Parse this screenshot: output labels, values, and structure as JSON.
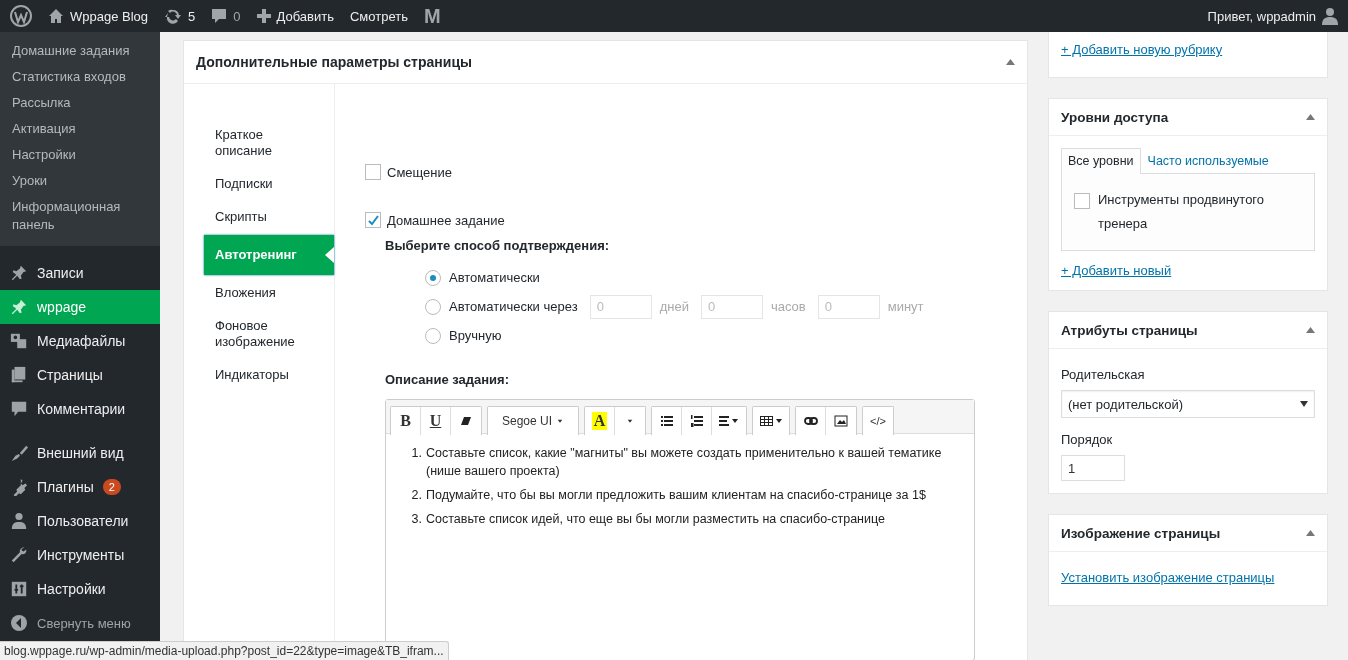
{
  "admin_bar": {
    "site": "Wppage Blog",
    "updates": "5",
    "comments": "0",
    "add": "Добавить",
    "view": "Смотреть",
    "plugin_logo": "M",
    "greeting": "Привет, wppadmin"
  },
  "sidebar": {
    "submenu": [
      "Домашние задания",
      "Статистика входов",
      "Рассылка",
      "Активация",
      "Настройки",
      "Уроки",
      "Информационная панель"
    ],
    "menu_groups": [
      [
        {
          "kind": "pin",
          "label": "Записи",
          "selected": false
        },
        {
          "kind": "pin",
          "label": "wppage",
          "selected": true
        },
        {
          "kind": "media",
          "label": "Медиафайлы",
          "selected": false
        },
        {
          "kind": "pages",
          "label": "Страницы",
          "selected": false
        },
        {
          "kind": "comments",
          "label": "Комментарии",
          "selected": false
        }
      ],
      [
        {
          "kind": "brush",
          "label": "Внешний вид",
          "selected": false
        },
        {
          "kind": "plug",
          "label": "Плагины",
          "selected": false,
          "badge": "2"
        },
        {
          "kind": "user",
          "label": "Пользователи",
          "selected": false
        },
        {
          "kind": "wrench",
          "label": "Инструменты",
          "selected": false
        },
        {
          "kind": "sliders",
          "label": "Настройки",
          "selected": false
        }
      ]
    ],
    "collapse": "Свернуть меню"
  },
  "panel": {
    "title": "Дополнительные параметры страницы",
    "tabs": [
      {
        "label": "Краткое описание",
        "selected": false
      },
      {
        "label": "Подписки",
        "selected": false
      },
      {
        "label": "Скрипты",
        "selected": false
      },
      {
        "label": "Автотренинг",
        "selected": true
      },
      {
        "label": "Вложения",
        "selected": false
      },
      {
        "label": "Фоновое изображение",
        "selected": false
      },
      {
        "label": "Индикаторы",
        "selected": false
      }
    ],
    "checkboxes": [
      {
        "label": "Смещение",
        "checked": false
      },
      {
        "label": "Домашнее задание",
        "checked": true
      }
    ],
    "confirm_label": "Выберите способ подтверждения:",
    "radios": [
      {
        "label": "Автоматически",
        "selected": true
      },
      {
        "label": "Автоматически через",
        "selected": false,
        "fields": [
          {
            "value": "0",
            "unit": "дней"
          },
          {
            "value": "0",
            "unit": "часов"
          },
          {
            "value": "0",
            "unit": "минут"
          }
        ]
      },
      {
        "label": "Вручную",
        "selected": false
      }
    ],
    "description_label": "Описание задания:",
    "toolbar": [
      [
        {
          "kind": "bold",
          "label": "B"
        },
        {
          "kind": "underline",
          "label": "U"
        },
        {
          "kind": "eraser"
        }
      ],
      [
        {
          "kind": "font",
          "label": "Segoe UI"
        }
      ],
      [
        {
          "kind": "highlight",
          "label": "A"
        },
        {
          "kind": "caret"
        }
      ],
      [
        {
          "kind": "bullets"
        },
        {
          "kind": "numbers"
        },
        {
          "kind": "align"
        }
      ],
      [
        {
          "kind": "table"
        }
      ],
      [
        {
          "kind": "link"
        },
        {
          "kind": "image"
        }
      ],
      [
        {
          "kind": "code",
          "label": "</>"
        }
      ]
    ],
    "items": [
      {
        "number": "1.",
        "text": "Составьте список, какие \"магниты\" вы можете создать применительно к вашей тематике (нише вашего проекта)"
      },
      {
        "number": "2.",
        "text": "Подумайте, что бы вы могли предложить вашим клиентам на спасибо-странице за 1$"
      },
      {
        "number": "3.",
        "text": "Составьте список идей, что еще вы бы могли разместить на спасибо-странице"
      }
    ]
  },
  "categories": {
    "add_link": "+ Добавить новую рубрику"
  },
  "access": {
    "title": "Уровни доступа",
    "tabs": [
      {
        "label": "Все уровни",
        "selected": true
      },
      {
        "label": "Часто используемые",
        "selected": false
      }
    ],
    "options": [
      {
        "label": "Инструменты продвинутого тренера",
        "checked": false
      }
    ],
    "add_link": "+ Добавить новый"
  },
  "attributes": {
    "title": "Атрибуты страницы",
    "parent_label": "Родительская",
    "parent_value": "(нет родительской)",
    "order_label": "Порядок",
    "order_value": "1"
  },
  "featured": {
    "title": "Изображение страницы",
    "link": "Установить изображение страницы"
  },
  "status_bar": "blog.wppage.ru/wp-admin/media-upload.php?post_id=22&type=image&TB_ifram..."
}
